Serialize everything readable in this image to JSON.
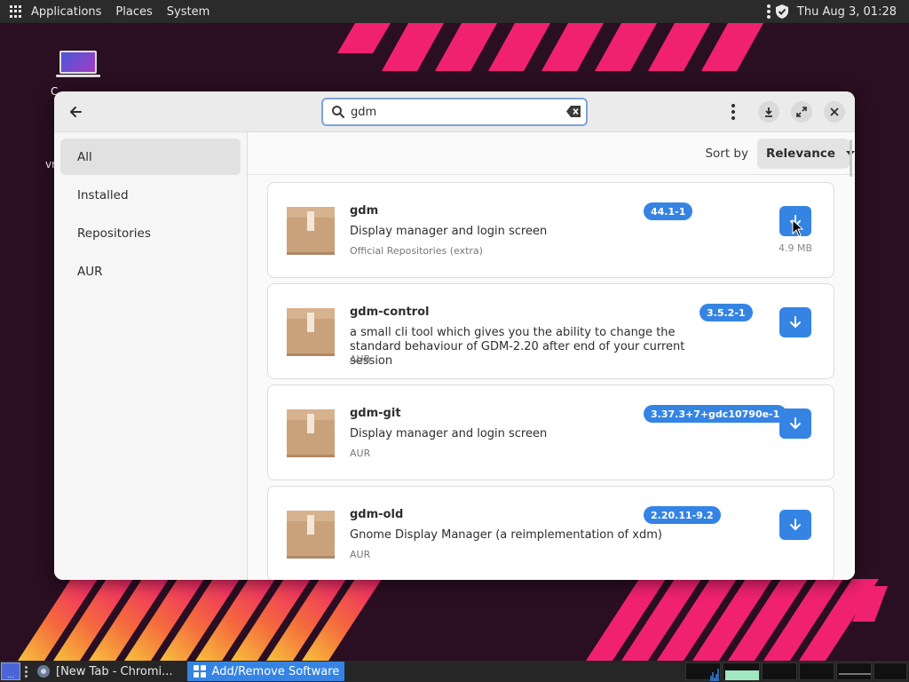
{
  "top_panel": {
    "menus": [
      "Applications",
      "Places",
      "System"
    ],
    "clock": "Thu Aug  3, 01:28"
  },
  "desktop": {
    "icon_label": "C",
    "icon_label2": "vr"
  },
  "window": {
    "search": {
      "value": "gdm",
      "placeholder": ""
    },
    "sidebar": {
      "items": [
        {
          "label": "All",
          "active": true
        },
        {
          "label": "Installed",
          "active": false
        },
        {
          "label": "Repositories",
          "active": false
        },
        {
          "label": "AUR",
          "active": false
        }
      ]
    },
    "sort": {
      "label": "Sort by",
      "value": "Relevance"
    },
    "packages": [
      {
        "name": "gdm",
        "description": "Display manager and login screen",
        "repo": "Official Repositories (extra)",
        "version": "44.1-1",
        "size": "4.9 MB"
      },
      {
        "name": "gdm-control",
        "description": "a small cli tool which gives you the ability to change the standard behaviour of GDM-2.20 after end of your current session",
        "repo": "AUR",
        "version": "3.5.2-1",
        "size": ""
      },
      {
        "name": "gdm-git",
        "description": "Display manager and login screen",
        "repo": "AUR",
        "version": "3.37.3+7+gdc10790e-1",
        "size": ""
      },
      {
        "name": "gdm-old",
        "description": "Gnome Display Manager (a reimplementation of xdm)",
        "repo": "AUR",
        "version": "2.20.11-9.2",
        "size": ""
      }
    ]
  },
  "taskbar": {
    "tasks": [
      {
        "label": "[New Tab - Chromi...",
        "active": false
      },
      {
        "label": "Add/Remove Software",
        "active": true
      }
    ]
  },
  "colors": {
    "accent": "#3584e4",
    "wallpaper_bg": "#2a0e22",
    "stripe_pink": "#f0226f",
    "stripe_orange": "#f7a93b"
  },
  "icons": {
    "back": "arrow-left-icon",
    "search": "search-icon",
    "clear": "backspace-clear-icon",
    "menu": "vertical-dots-icon",
    "download": "download-icon",
    "maximize": "expand-icon",
    "close": "close-icon",
    "package": "package-box-icon",
    "shield": "shield-check-icon"
  }
}
